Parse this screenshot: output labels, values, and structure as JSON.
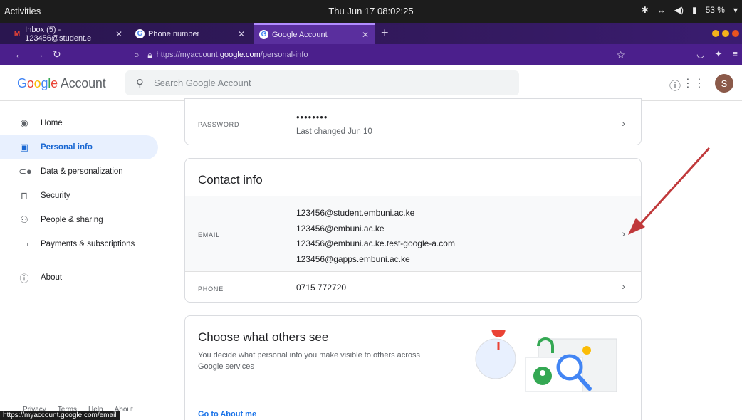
{
  "system": {
    "activities": "Activities",
    "clock": "Thu Jun 17  08:02:25",
    "battery": "53 %"
  },
  "browser": {
    "tabs": [
      {
        "label": "Inbox (5) - 123456@student.e",
        "favicon": "gmail-icon"
      },
      {
        "label": "Phone number",
        "favicon": "google-icon"
      },
      {
        "label": "Google Account",
        "favicon": "google-icon",
        "active": true
      }
    ],
    "url": {
      "prefix": "https://myaccount.",
      "host": "google.com",
      "path": "/personal-info"
    }
  },
  "header": {
    "logo_g": "G",
    "logo_o1": "o",
    "logo_o2": "o",
    "logo_g2": "g",
    "logo_l": "l",
    "logo_e": "e",
    "logo_suffix": "Account",
    "search_placeholder": "Search Google Account",
    "avatar_initial": "S"
  },
  "sidebar": {
    "items": [
      {
        "label": "Home",
        "icon": "account-circle-icon"
      },
      {
        "label": "Personal info",
        "icon": "id-card-icon",
        "active": true
      },
      {
        "label": "Data & personalization",
        "icon": "toggle-icon"
      },
      {
        "label": "Security",
        "icon": "lock-icon"
      },
      {
        "label": "People & sharing",
        "icon": "people-icon"
      },
      {
        "label": "Payments & subscriptions",
        "icon": "credit-card-icon"
      },
      {
        "label": "About",
        "icon": "info-icon"
      }
    ],
    "footer": [
      "Privacy",
      "Terms",
      "Help",
      "About"
    ]
  },
  "password_card": {
    "label": "PASSWORD",
    "value": "••••••••",
    "subtext": "Last changed Jun 10"
  },
  "contact_card": {
    "title": "Contact info",
    "email_label": "EMAIL",
    "emails": [
      "123456@student.embuni.ac.ke",
      "123456@embuni.ac.ke",
      "123456@embuni.ac.ke.test-google-a.com",
      "123456@gapps.embuni.ac.ke"
    ],
    "phone_label": "PHONE",
    "phone": "0715 772720"
  },
  "choose_card": {
    "title": "Choose what others see",
    "description": "You decide what personal info you make visible to others across Google services",
    "link": "Go to About me"
  },
  "status_url": "https://myaccount.google.com/email",
  "colors": {
    "accent": "#1a73e8",
    "active_bg": "#e8f0fe",
    "firefox_purple": "#4b1f8c",
    "annotation_arrow": "#c0393b"
  }
}
